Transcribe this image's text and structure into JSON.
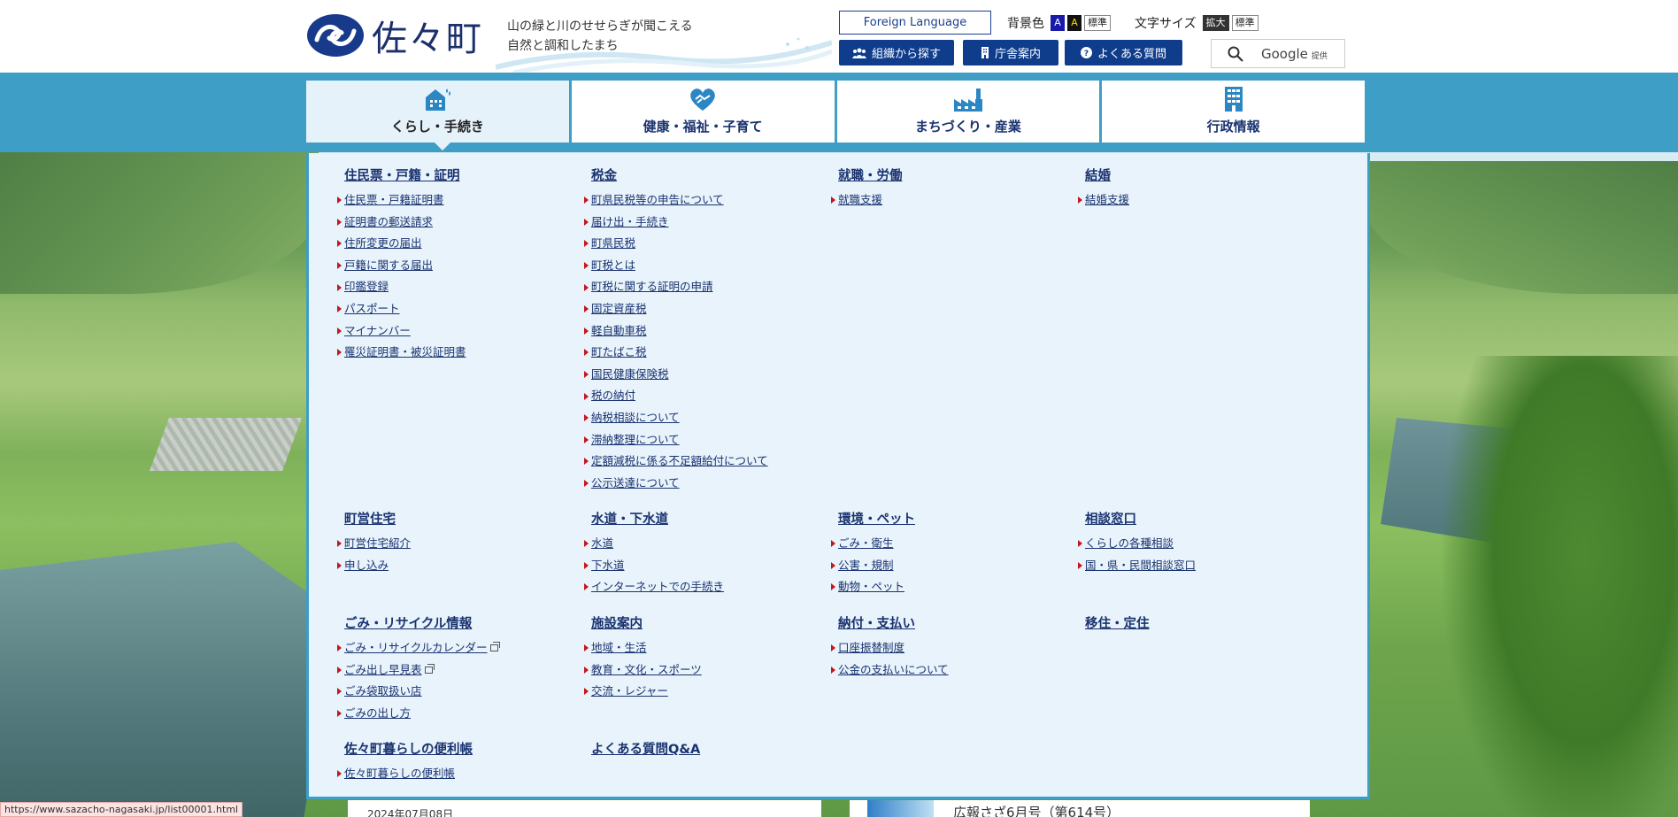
{
  "header": {
    "logo_name": "佐々町",
    "tagline_line1": "山の緑と川のせせらぎが聞こえる",
    "tagline_line2": "自然と調和したまち",
    "foreign_language": "Foreign Language",
    "bg_color_label": "背景色",
    "bg_blue": "A",
    "bg_black": "A",
    "bg_standard": "標準",
    "font_size_label": "文字サイズ",
    "font_large": "拡大",
    "font_standard": "標準",
    "btn_org": "組織から探す",
    "btn_office": "庁舎案内",
    "btn_faq": "よくある質問",
    "search_label": "Google",
    "search_provider": "提供"
  },
  "gnav": [
    {
      "label": "くらし・手続き",
      "icon": "house-icon"
    },
    {
      "label": "健康・福祉・子育て",
      "icon": "heart-hands-icon"
    },
    {
      "label": "まちづくり・産業",
      "icon": "factory-icon"
    },
    {
      "label": "行政情報",
      "icon": "building-icon"
    }
  ],
  "menu": {
    "c1": {
      "title": "住民票・戸籍・証明",
      "items": [
        "住民票・戸籍証明書",
        "証明書の郵送請求",
        "住所変更の届出",
        "戸籍に関する届出",
        "印鑑登録",
        "パスポート",
        "マイナンバー",
        "罹災証明書・被災証明書"
      ]
    },
    "c2": {
      "title": "税金",
      "items": [
        "町県民税等の申告について",
        "届け出・手続き",
        "町県民税",
        "町税とは",
        "町税に関する証明の申請",
        "固定資産税",
        "軽自動車税",
        "町たばこ税",
        "国民健康保険税",
        "税の納付",
        "納税相談について",
        "滞納整理について",
        "定額減税に係る不足額給付について",
        "公示送達について"
      ]
    },
    "c3": {
      "title": "就職・労働",
      "items": [
        "就職支援"
      ]
    },
    "c4": {
      "title": "結婚",
      "items": [
        "結婚支援"
      ]
    },
    "c5": {
      "title": "町営住宅",
      "items": [
        "町営住宅紹介",
        "申し込み"
      ]
    },
    "c6": {
      "title": "水道・下水道",
      "items": [
        "水道",
        "下水道",
        "インターネットでの手続き"
      ]
    },
    "c7": {
      "title": "環境・ペット",
      "items": [
        "ごみ・衛生",
        "公害・規制",
        "動物・ペット"
      ]
    },
    "c8": {
      "title": "相談窓口",
      "items": [
        "くらしの各種相談",
        "国・県・民間相談窓口"
      ]
    },
    "c9": {
      "title": "ごみ・リサイクル情報",
      "items": [
        "ごみ・リサイクルカレンダー",
        "ごみ出し早見表",
        "ごみ袋取扱い店",
        "ごみの出し方"
      ]
    },
    "c10": {
      "title": "施設案内",
      "items": [
        "地域・生活",
        "教育・文化・スポーツ",
        "交流・レジャー"
      ]
    },
    "c11": {
      "title": "納付・支払い",
      "items": [
        "口座振替制度",
        "公金の支払いについて"
      ]
    },
    "c12": {
      "title": "移住・定住",
      "items": []
    },
    "c13": {
      "title": "佐々町暮らしの便利帳",
      "items": [
        "佐々町暮らしの便利帳"
      ]
    },
    "c14": {
      "title": "よくある質問Q&A",
      "items": []
    }
  },
  "below": {
    "card1_date": "2024年07月08日",
    "card2_title": "広報さざ6月号（第614号）"
  },
  "status_url": "https://www.sazacho-nagasaki.jp/list00001.html",
  "colors": {
    "brand_blue": "#0f3d8c",
    "band": "#3e9ec6",
    "menu_bg": "#e8f3fb",
    "bullet": "#c4161c"
  }
}
